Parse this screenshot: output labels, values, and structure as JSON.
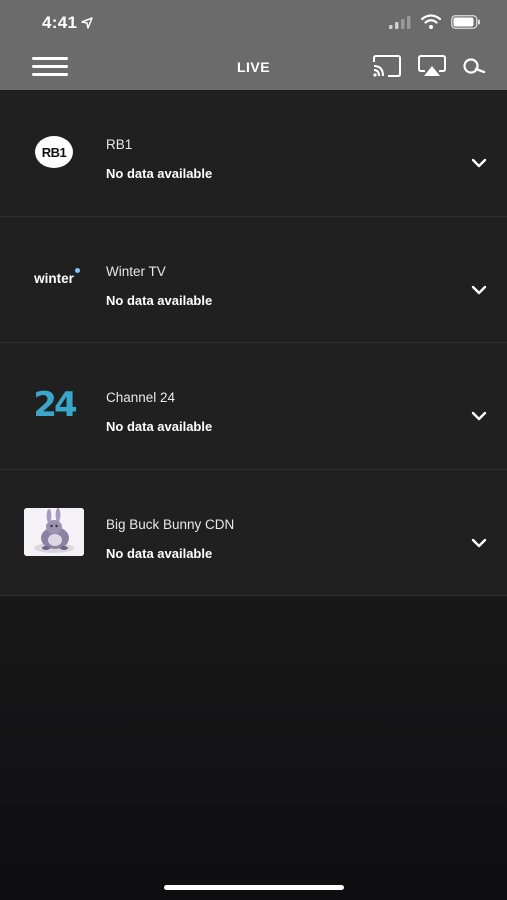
{
  "status_bar": {
    "time": "4:41"
  },
  "nav": {
    "title": "LIVE"
  },
  "channels": [
    {
      "name": "RB1",
      "status": "No data available",
      "logo_text": "RB1"
    },
    {
      "name": "Winter TV",
      "status": "No data available",
      "logo_text": "winter"
    },
    {
      "name": "Channel 24",
      "status": "No data available",
      "logo_text": "24"
    },
    {
      "name": "Big Buck Bunny CDN",
      "status": "No data available",
      "logo_text": ""
    }
  ],
  "colors": {
    "bar_bg": "#6b6b6b",
    "row_bg": "#202020",
    "accent_24": "#3aa6c9"
  }
}
